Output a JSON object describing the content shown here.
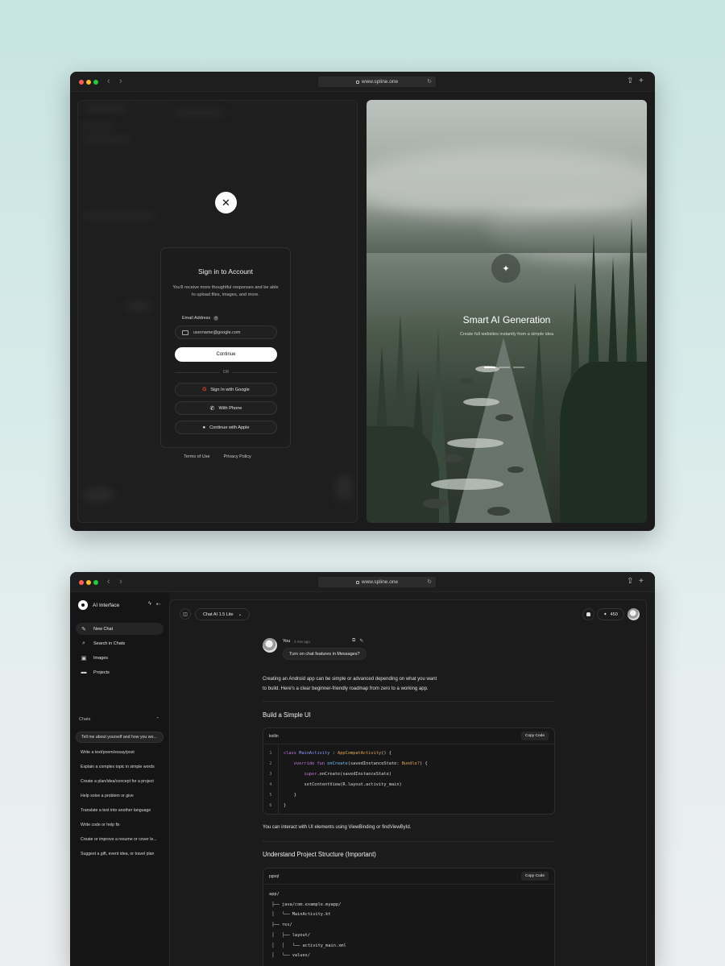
{
  "browser": {
    "url": "www.spline.one",
    "lock_icon": "lock-icon",
    "reload_icon": "↻",
    "back_icon": "‹",
    "forward_icon": "›",
    "share_icon": "⇪",
    "new_tab_icon": "+"
  },
  "signin": {
    "close_icon": "✕",
    "title": "Sign in to Account",
    "subtitle": "You'll receive more thoughtful responses and be able to upload files, images, and more.",
    "email_label": "Email Address",
    "email_help_icon": "?",
    "email_placeholder": "username@google.com",
    "continue_label": "Continue",
    "or_label": "OR",
    "google_label": "Sign In with Google",
    "google_icon": "G",
    "phone_label": "With Phone",
    "phone_icon": "✆",
    "apple_label": "Continue with Apple",
    "apple_icon": "●",
    "terms_label": "Terms of Use",
    "privacy_label": "Privacy Policy"
  },
  "hero": {
    "sparkle_icon": "✦",
    "title": "Smart AI Generation",
    "subtitle": "Create full websites instantly from a simple idea"
  },
  "app": {
    "name": "AI Interface",
    "bolt_icon": "ϟ",
    "collapse_icon": "⇠",
    "nav": [
      {
        "label": "New Chat",
        "icon": "✎"
      },
      {
        "label": "Search in Chats",
        "icon": "⌕"
      },
      {
        "label": "Images",
        "icon": "▣"
      },
      {
        "label": "Projects",
        "icon": "▬"
      }
    ],
    "chats_heading": "Chats",
    "chats_toggle_icon": "⌃",
    "chats": [
      "Tell me about yourself and how you wo...",
      "Write a text/poem/essay/post",
      "Explain a complex topic in simple words",
      "Create a plan/idea/concept for a project",
      "Help solve a problem or give",
      "Translate a text into another language",
      "Write code or help fix",
      "Create or improve a resume or cover le...",
      "Suggest a gift, event idea, or travel plan"
    ]
  },
  "topbar": {
    "sidebar_toggle_icon": "◫",
    "model": "Chat AI 1.5 Lite",
    "model_chevron": "⌄",
    "bell_icon": "🔔",
    "credits_icon": "✦",
    "credits": "450"
  },
  "conversation": {
    "user_name": "You",
    "time": "2 min ago",
    "copy_icon": "⧉",
    "edit_icon": "✎",
    "user_message": "Turn on chat features in Messages?",
    "intro_line1": "Creating an Android app can be simple or advanced depending on what you want",
    "intro_line2": "to build. Here's a clear beginner-friendly roadmap from zero to a working app.",
    "section1_title": "Build a Simple UI",
    "code1_lang": "kotlin",
    "copy_code_label": "Copy Code",
    "code1_lines": [
      {
        "n": "1",
        "parts": [
          [
            "kw",
            "class "
          ],
          [
            "cls",
            "MainActivity"
          ],
          [
            "",
            " : "
          ],
          [
            "typ",
            "AppCompatActivity"
          ],
          [
            "",
            "() {"
          ]
        ]
      },
      {
        "n": "2",
        "parts": [
          [
            "",
            "    "
          ],
          [
            "kw",
            "override fun "
          ],
          [
            "fn",
            "onCreate"
          ],
          [
            "",
            "(savedInstanceState: "
          ],
          [
            "typ",
            "Bundle?"
          ],
          [
            "",
            ") {"
          ]
        ]
      },
      {
        "n": "3",
        "parts": [
          [
            "",
            "        "
          ],
          [
            "kw",
            "super"
          ],
          [
            "",
            ".onCreate(savedInstanceState)"
          ]
        ]
      },
      {
        "n": "4",
        "parts": [
          [
            "",
            "        setContentView(R.layout.activity_main)"
          ]
        ]
      },
      {
        "n": "5",
        "parts": [
          [
            "",
            "    }"
          ]
        ]
      },
      {
        "n": "6",
        "parts": [
          [
            "",
            "}"
          ]
        ]
      }
    ],
    "after_code_text": "You can interact with UI elements using ViewBinding or findViewById.",
    "section2_title": "Understand Project Structure (Important)",
    "code2_lang": "pgsql",
    "code2_lines": [
      "app/",
      " ├── java/com.example.myapp/",
      " │   └── MainActivity.kt",
      " ├── res/",
      " │   ├── layout/",
      " │   │   └── activity_main.xml",
      " │   └── values/"
    ]
  }
}
